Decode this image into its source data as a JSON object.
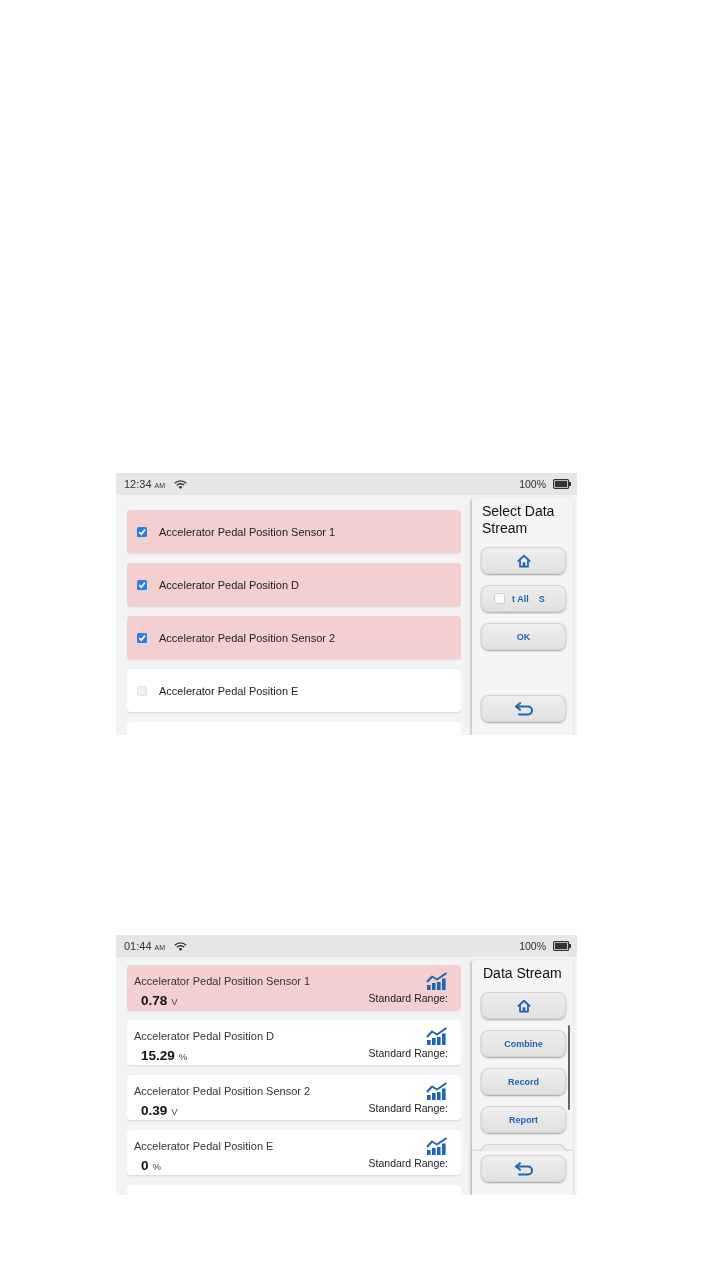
{
  "screens": [
    {
      "kind": "select",
      "status_bar": {
        "time": "12:34",
        "meridiem": "AM",
        "battery": "100%"
      },
      "list": {
        "more_below": true,
        "items": [
          {
            "name": "Accelerator Pedal Position Sensor 1",
            "checked": true
          },
          {
            "name": "Accelerator Pedal Position D",
            "checked": true
          },
          {
            "name": "Accelerator Pedal Position Sensor 2",
            "checked": true
          },
          {
            "name": "Accelerator Pedal Position E",
            "checked": false
          }
        ]
      },
      "panel": {
        "title": "Select Data Stream",
        "scrollable": false,
        "buttons": [
          {
            "kind": "home"
          },
          {
            "kind": "select_all",
            "label": "t All    S",
            "checked": false
          },
          {
            "kind": "text",
            "label": "OK"
          }
        ],
        "footer_buttons": [
          {
            "kind": "back"
          }
        ]
      }
    },
    {
      "kind": "values",
      "status_bar": {
        "time": "01:44",
        "meridiem": "AM",
        "battery": "100%"
      },
      "list": {
        "more_below": true,
        "items": [
          {
            "name": "Accelerator Pedal Position Sensor 1",
            "value": "0.78",
            "unit": "V",
            "range_label": "Standard Range:",
            "selected": true
          },
          {
            "name": "Accelerator Pedal Position D",
            "value": "15.29",
            "unit": "%",
            "range_label": "Standard Range:",
            "selected": false
          },
          {
            "name": "Accelerator Pedal Position Sensor 2",
            "value": "0.39",
            "unit": "V",
            "range_label": "Standard Range:",
            "selected": false
          },
          {
            "name": "Accelerator Pedal Position E",
            "value": "0",
            "unit": "%",
            "range_label": "Standard Range:",
            "selected": false
          }
        ]
      },
      "panel": {
        "title": "Data Stream",
        "scrollable": true,
        "buttons": [
          {
            "kind": "home"
          },
          {
            "kind": "text",
            "label": "Combine"
          },
          {
            "kind": "text",
            "label": "Record"
          },
          {
            "kind": "text",
            "label": "Report"
          }
        ],
        "footer_buttons": [
          {
            "kind": "back"
          }
        ]
      }
    }
  ]
}
